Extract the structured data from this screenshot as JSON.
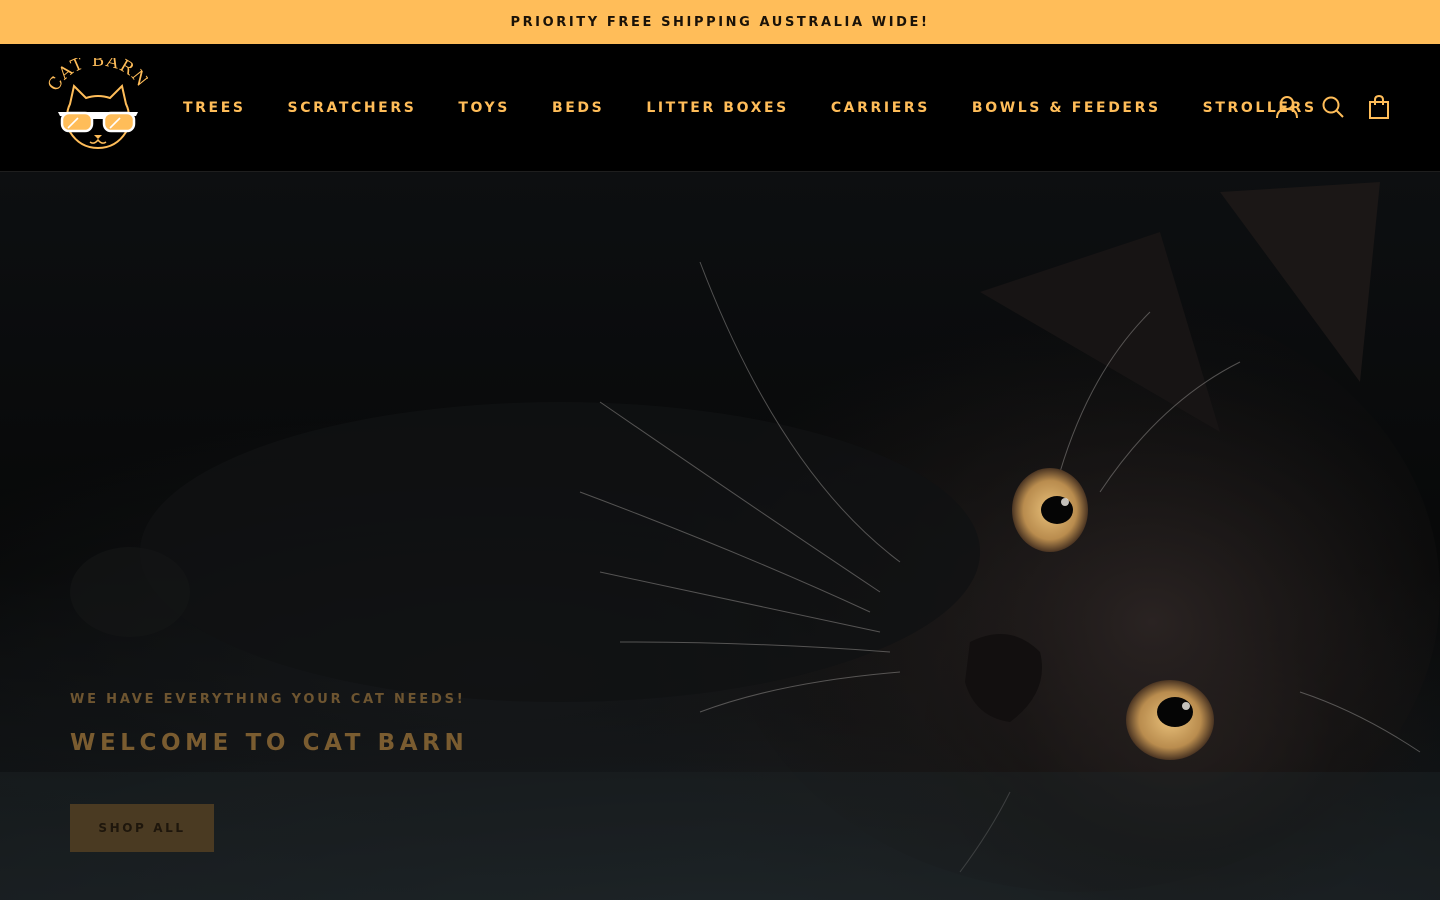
{
  "announcement": {
    "text": "PRIORITY FREE SHIPPING AUSTRALIA WIDE!"
  },
  "header": {
    "logo_text": "CAT BARN",
    "nav": [
      {
        "label": "TREES"
      },
      {
        "label": "SCRATCHERS"
      },
      {
        "label": "TOYS"
      },
      {
        "label": "BEDS"
      },
      {
        "label": "LITTER BOXES"
      },
      {
        "label": "CARRIERS"
      },
      {
        "label": "BOWLS & FEEDERS"
      },
      {
        "label": "STROLLERS"
      }
    ],
    "icons": [
      "account-icon",
      "search-icon",
      "cart-icon"
    ]
  },
  "hero": {
    "subtitle": "WE HAVE EVERYTHING YOUR CAT NEEDS!",
    "title": "WELCOME TO CAT BARN",
    "button_label": "SHOP ALL"
  },
  "colors": {
    "accent": "#ffbd59",
    "header_bg": "#000000",
    "announcement_text": "#1a1208"
  }
}
